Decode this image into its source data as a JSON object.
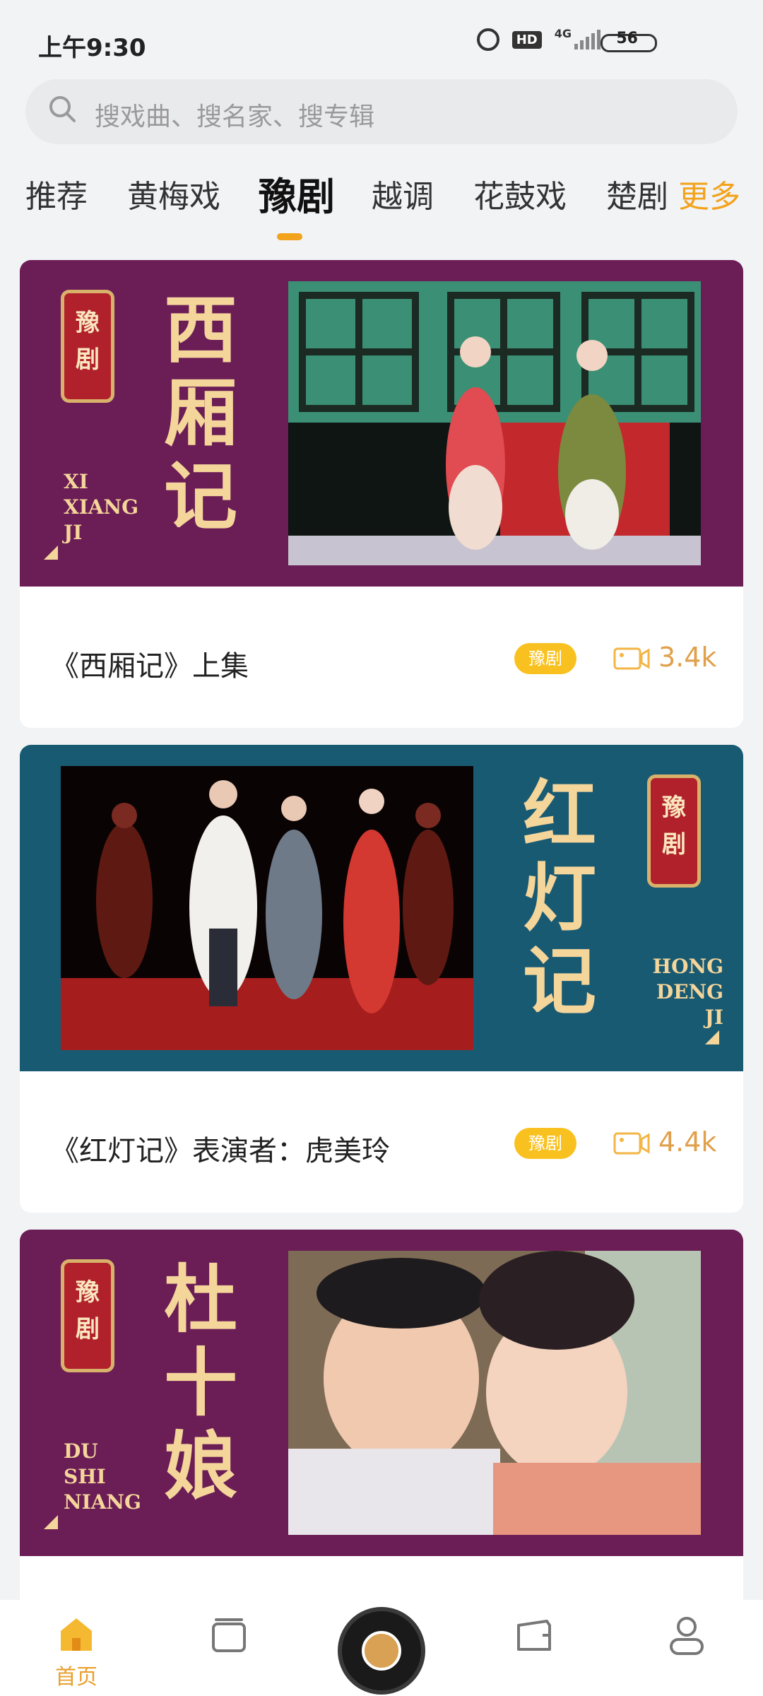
{
  "status": {
    "time": "上午9:30",
    "hd": "HD",
    "network": "4G",
    "battery": "56"
  },
  "search": {
    "placeholder": "搜戏曲、搜名家、搜专辑"
  },
  "tabs": [
    {
      "label": "推荐"
    },
    {
      "label": "黄梅戏"
    },
    {
      "label": "豫剧",
      "active": true
    },
    {
      "label": "越调"
    },
    {
      "label": "花鼓戏"
    },
    {
      "label": "楚剧"
    },
    {
      "label": "更多"
    }
  ],
  "cards": [
    {
      "banner_seal": [
        "豫",
        "剧"
      ],
      "banner_title": [
        "西",
        "厢",
        "记"
      ],
      "banner_pinyin": [
        "XI",
        "XIANG",
        "JI"
      ],
      "title": "《西厢记》上集",
      "genre": "豫剧",
      "views": "3.4k"
    },
    {
      "banner_seal": [
        "豫",
        "剧"
      ],
      "banner_title": [
        "红",
        "灯",
        "记"
      ],
      "banner_pinyin": [
        "HONG",
        "DENG",
        "JI"
      ],
      "title": "《红灯记》表演者：虎美玲",
      "genre": "豫剧",
      "views": "4.4k"
    },
    {
      "banner_seal": [
        "豫",
        "剧"
      ],
      "banner_title": [
        "杜",
        "十",
        "娘"
      ],
      "banner_pinyin": [
        "DU",
        "SHI",
        "NIANG"
      ]
    }
  ],
  "bottom_nav": {
    "home_label": "首页"
  },
  "colors": {
    "accent": "#f3a21b",
    "banner_purple": "#6b1d56",
    "banner_teal": "#195a73",
    "genre_badge": "#f9c11f",
    "views": "#e0a04b"
  }
}
